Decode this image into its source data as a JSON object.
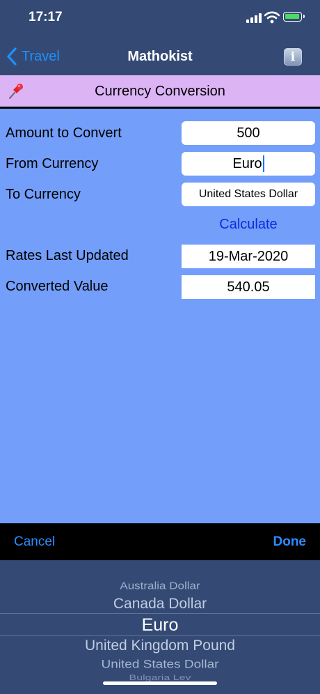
{
  "status_bar": {
    "time": "17:17"
  },
  "nav": {
    "back_label": "Travel",
    "title": "Mathokist",
    "info_label": "i"
  },
  "header": {
    "title": "Currency Conversion"
  },
  "form": {
    "amount": {
      "label": "Amount to Convert",
      "value": "500"
    },
    "from": {
      "label": "From Currency",
      "value": "Euro"
    },
    "to": {
      "label": "To Currency",
      "value": "United States Dollar"
    },
    "calculate_label": "Calculate",
    "rates_updated": {
      "label": "Rates Last Updated",
      "value": "19-Mar-2020"
    },
    "converted": {
      "label": "Converted Value",
      "value": "540.05"
    }
  },
  "toolbar": {
    "cancel_label": "Cancel",
    "done_label": "Done"
  },
  "picker": {
    "options": [
      "Australia Dollar",
      "Canada Dollar",
      "Euro",
      "United Kingdom Pound",
      "United States Dollar",
      "Bulgaria Lev"
    ],
    "selected": "Euro"
  },
  "colors": {
    "nav_bg": "#344a74",
    "header_bg": "#dcb4f5",
    "form_bg": "#739ef9",
    "link_blue": "#1e90ff",
    "calculate_blue": "#0a2ce0",
    "battery_green": "#4cd964"
  },
  "icons": [
    "signal-icon",
    "wifi-icon",
    "battery-icon",
    "back-chevron-icon",
    "info-icon",
    "pushpin-icon"
  ]
}
